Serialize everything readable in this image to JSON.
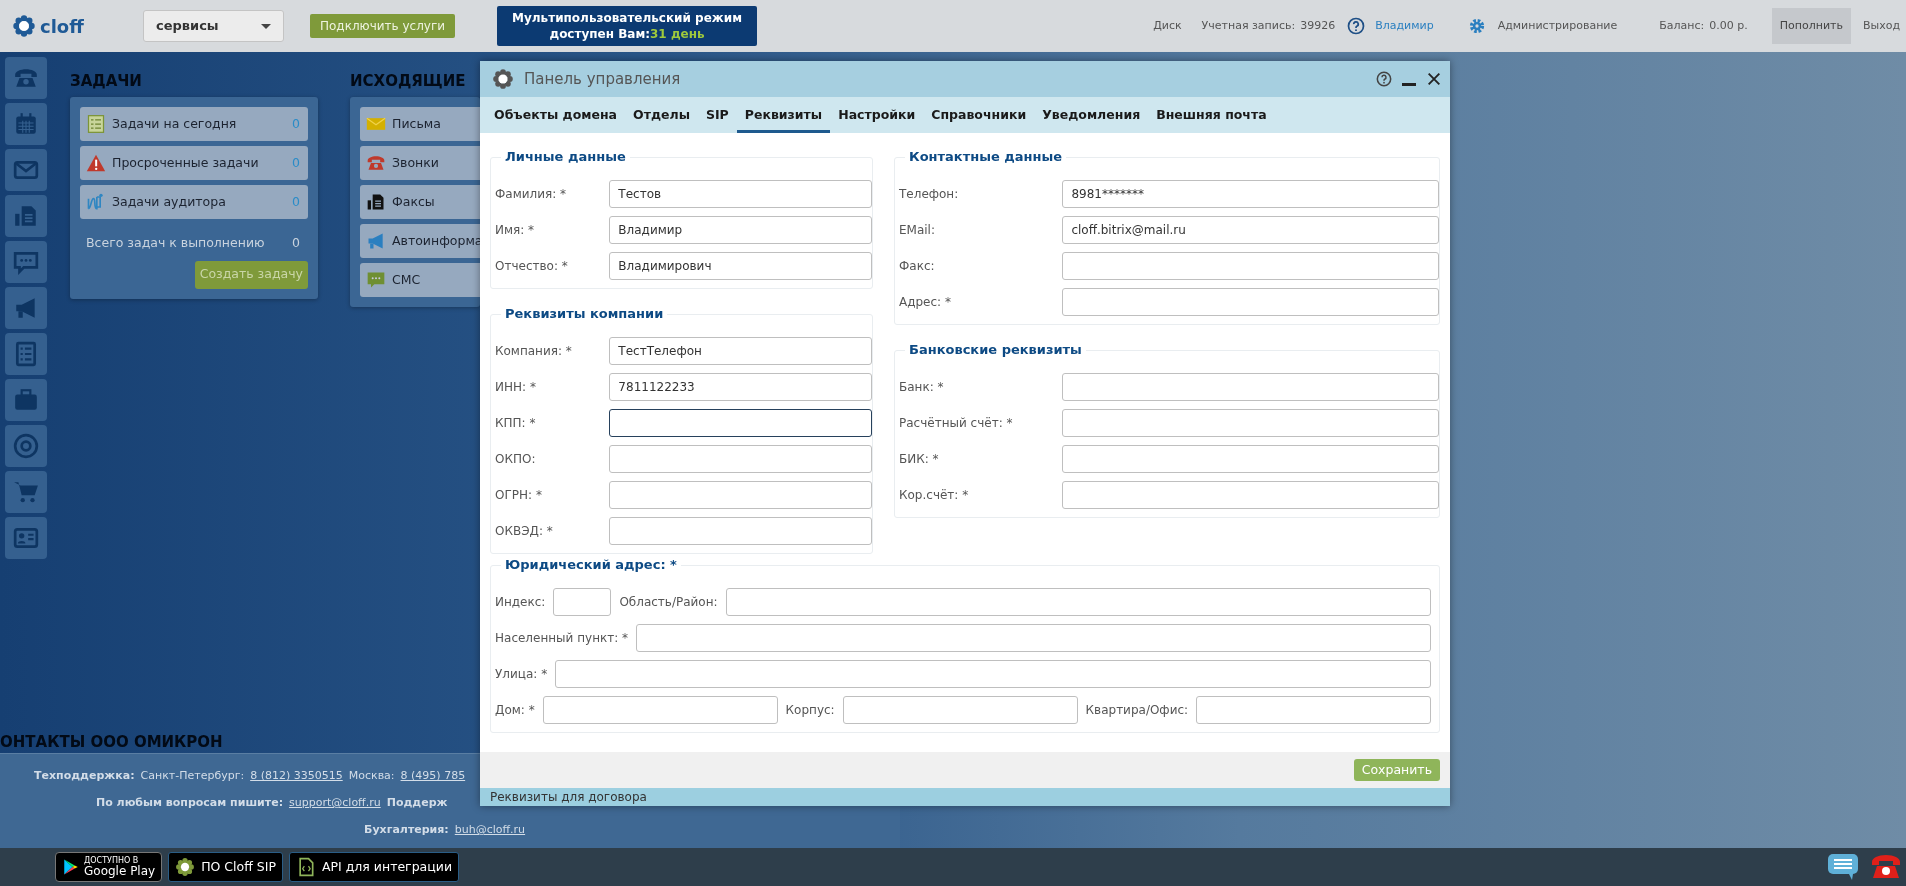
{
  "top_bar": {
    "logo": "cloff",
    "service_select": "сервисы",
    "connect_button": "Подключить услуги",
    "banner": {
      "line1": "Мультипользовательский режим",
      "line2": "доступен Вам:",
      "highlight": "31 день"
    },
    "disk_link": "Диск",
    "account_label": "Учетная запись:",
    "account_number": "39926",
    "user_link": "Владимир",
    "admin_link": "Администрирование",
    "balance_label": "Баланс:",
    "balance_value": "0.00 р.",
    "topup_button": "Пополнить",
    "logout_link": "Выход"
  },
  "tasks": {
    "title": "ЗАДАЧИ",
    "items": [
      {
        "label": "Задачи на сегодня",
        "count": "0"
      },
      {
        "label": "Просроченные задачи",
        "count": "0"
      },
      {
        "label": "Задачи аудитора",
        "count": "0"
      }
    ],
    "total_label": "Всего задач к выполнению",
    "total": "0",
    "create_button": "Создать задачу"
  },
  "outgoing": {
    "title": "ИСХОДЯЩИЕ",
    "items": [
      "Письма",
      "Звонки",
      "Факсы",
      "Автоинформа",
      "СМС"
    ]
  },
  "contacts": {
    "title": "ОНТАКТЫ ООО ОМИКРОН",
    "lines": [
      [
        {
          "kind": "label",
          "text": "Техподдержка:"
        },
        {
          "kind": "text",
          "text": "Санкт-Петербург:"
        },
        {
          "kind": "link",
          "text": "8 (812) 3350515"
        },
        {
          "kind": "text",
          "text": "Москва:"
        },
        {
          "kind": "link",
          "text": "8 (495) 785"
        }
      ],
      [
        {
          "kind": "label",
          "text": "По любым вопросам пишите:"
        },
        {
          "kind": "link",
          "text": "support@cloff.ru"
        },
        {
          "kind": "label",
          "text": "Поддерж"
        }
      ],
      [
        {
          "kind": "label",
          "text": "Бухгалтерия:"
        },
        {
          "kind": "link",
          "text": "buh@cloff.ru"
        }
      ]
    ]
  },
  "bottom_bar": {
    "google_play": {
      "small": "ДОСТУПНО В",
      "big": "Google Play"
    },
    "buttons": [
      "ПО Cloff SIP",
      "API для интеграции"
    ]
  },
  "modal": {
    "title": "Панель управления",
    "tabs": [
      {
        "label": "Объекты домена",
        "selected": false
      },
      {
        "label": "Отделы",
        "selected": false
      },
      {
        "label": "SIP",
        "selected": false
      },
      {
        "label": "Реквизиты",
        "selected": true
      },
      {
        "label": "Настройки",
        "selected": false
      },
      {
        "label": "Справочники",
        "selected": false
      },
      {
        "label": "Уведомления",
        "selected": false
      },
      {
        "label": "Внешняя почта",
        "selected": false
      }
    ],
    "left_column": [
      {
        "title": "Личные данные",
        "fields": [
          {
            "label": "Фамилия: *",
            "value": "Тестов",
            "focused": false
          },
          {
            "label": "Имя: *",
            "value": "Владимир",
            "focused": false
          },
          {
            "label": "Отчество: *",
            "value": "Владимирович",
            "focused": false
          }
        ]
      },
      {
        "title": "Реквизиты компании",
        "fields": [
          {
            "label": "Компания: *",
            "value": "ТестТелефон",
            "focused": false
          },
          {
            "label": "ИНН: *",
            "value": "7811122233",
            "focused": false
          },
          {
            "label": "КПП: *",
            "focused": true
          },
          {
            "label": "ОКПО:",
            "focused": false
          },
          {
            "label": "ОГРН: *",
            "focused": false
          },
          {
            "label": "ОКВЭД: *",
            "focused": false
          }
        ]
      }
    ],
    "right_column": [
      {
        "title": "Контактные данные",
        "fields": [
          {
            "label": "Телефон:",
            "value": "8981*******",
            "focused": false
          },
          {
            "label": "EMail:",
            "value": "cloff.bitrix@mail.ru",
            "focused": false
          },
          {
            "label": "Факс:",
            "focused": false
          },
          {
            "label": "Адрес: *",
            "focused": false
          }
        ]
      },
      {
        "title": "Банковские реквизиты",
        "fields": [
          {
            "label": "Банк: *",
            "focused": false
          },
          {
            "label": "Расчётный счёт: *",
            "focused": false
          },
          {
            "label": "БИК: *",
            "focused": false
          },
          {
            "label": "Кор.счёт: *",
            "focused": false
          }
        ]
      }
    ],
    "legal_address": {
      "title": "Юридический адрес: *",
      "rows": [
        [
          {
            "label": "Индекс:",
            "kind": "short",
            "focused": false
          },
          {
            "label": "Область/Район:",
            "kind": "wide",
            "focused": false
          }
        ],
        [
          {
            "label": "Населенный пункт: *",
            "kind": "wide",
            "focused": false
          }
        ],
        [
          {
            "label": "Улица: *",
            "kind": "wide",
            "focused": false
          }
        ],
        [
          {
            "label": "Дом: *",
            "kind": "wide",
            "focused": false
          },
          {
            "label": "Корпус:",
            "kind": "wide",
            "focused": false
          },
          {
            "label": "Квартира/Офис:",
            "kind": "wide",
            "focused": false
          }
        ]
      ]
    },
    "save_button": "Сохранить",
    "status": "Реквизиты для договора"
  }
}
